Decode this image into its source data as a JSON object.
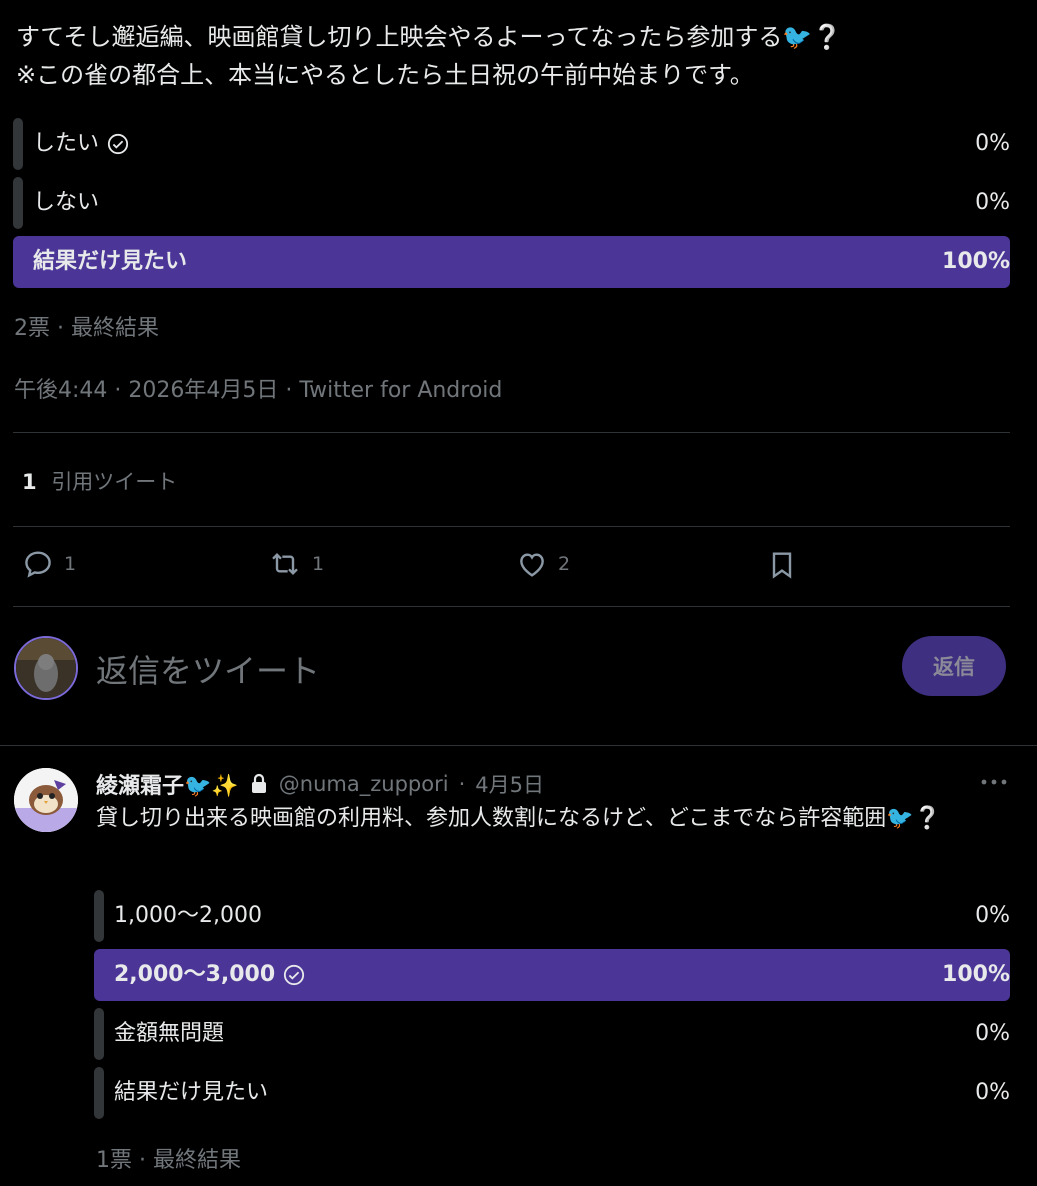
{
  "tweet": {
    "text": "すてそし邂逅編、映画館貸し切り上映会やるよーってなったら参加する🐦❔\n※この雀の都合上、本当にやるとしたら土日祝の午前中始まりです。",
    "poll": [
      {
        "label": "したい",
        "percent": "0%",
        "fraction": 0.0,
        "voted": true
      },
      {
        "label": "しない",
        "percent": "0%",
        "fraction": 0.0,
        "voted": false
      },
      {
        "label": "結果だけ見たい",
        "percent": "100%",
        "fraction": 1.0,
        "voted": false
      }
    ],
    "poll_meta": "2票 · 最終結果",
    "timestamp": "午後4:44 · 2026年4月5日 · Twitter for Android",
    "quote_count": "1",
    "quote_label": "引用ツイート",
    "actions": {
      "reply_count": "1",
      "retweet_count": "1",
      "like_count": "2"
    }
  },
  "reply_composer": {
    "placeholder": "返信をツイート",
    "button_label": "返信"
  },
  "reply_tweet": {
    "display_name": "綾瀬霜子🐦✨",
    "handle": "@numa_zuppori",
    "date": "4月5日",
    "text": "貸し切り出来る映画館の利用料、参加人数割になるけど、どこまでなら許容範囲🐦❔",
    "poll": [
      {
        "label": "1,000〜2,000",
        "percent": "0%",
        "fraction": 0.0,
        "voted": false
      },
      {
        "label": "2,000〜3,000",
        "percent": "100%",
        "fraction": 1.0,
        "voted": true
      },
      {
        "label": "金額無問題",
        "percent": "0%",
        "fraction": 0.0,
        "voted": false
      },
      {
        "label": "結果だけ見たい",
        "percent": "0%",
        "fraction": 0.0,
        "voted": false
      }
    ],
    "poll_meta": "1票 · 最終結果"
  },
  "colors": {
    "poll_winner": "#4b3596",
    "poll_track": "#333639",
    "muted_text": "#71767b",
    "background": "#000000"
  }
}
